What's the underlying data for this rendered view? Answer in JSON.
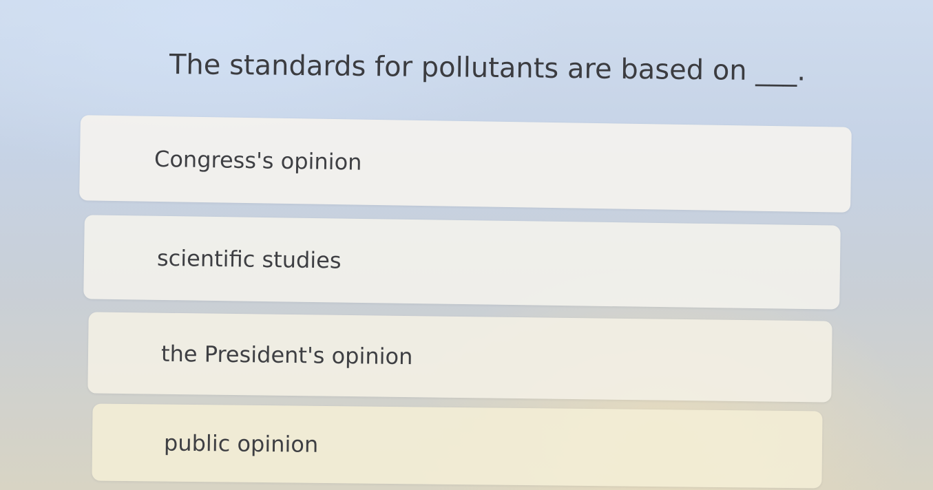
{
  "question": {
    "text": "The standards for pollutants are based on ___."
  },
  "options": [
    {
      "label": "Congress's opinion"
    },
    {
      "label": "scientific studies"
    },
    {
      "label": "the President's opinion"
    },
    {
      "label": "public opinion"
    }
  ]
}
